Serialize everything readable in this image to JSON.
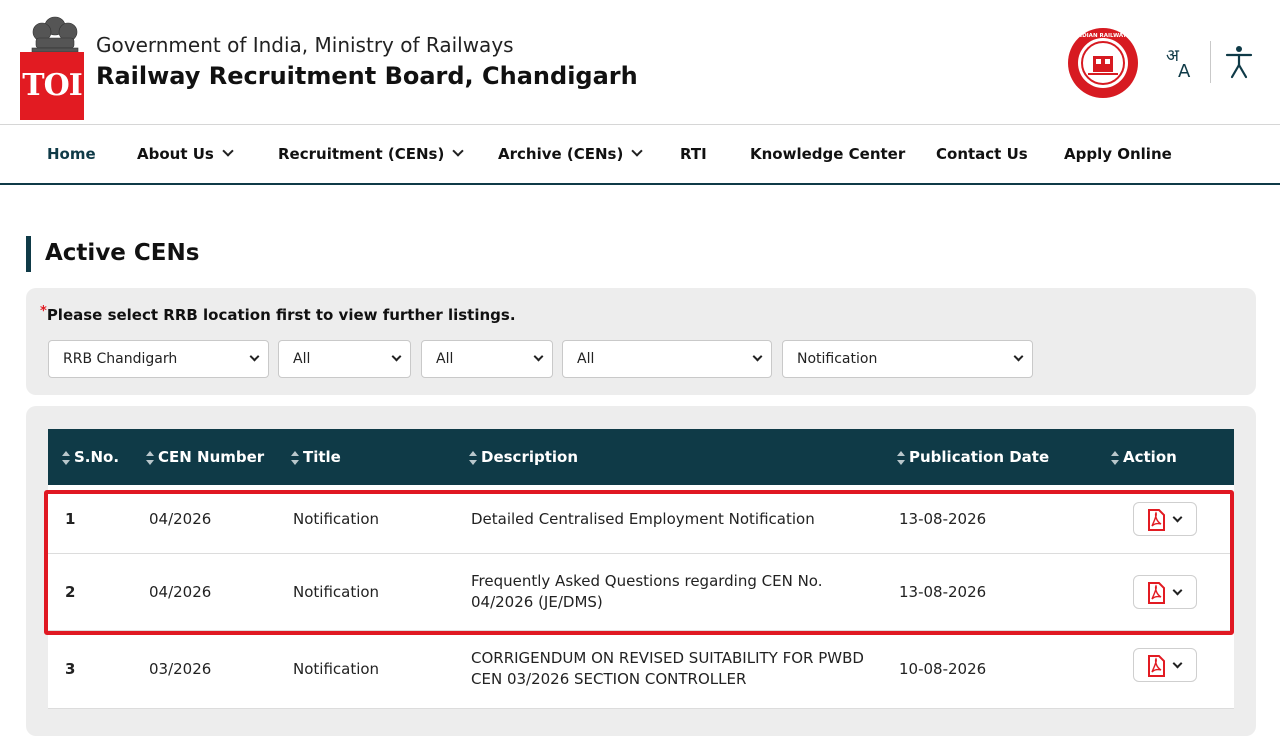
{
  "header": {
    "badge": "TOI",
    "gov_line": "Government of India, Ministry of Railways",
    "board_line": "Railway Recruitment Board, Chandigarh",
    "emblem_icon": "national-emblem-icon",
    "railways_logo": "indian-railways-logo",
    "railways_logo_text": "INDIAN RAILWAYS",
    "language_icon": "language-toggle-icon",
    "language_glyphs": [
      "अ",
      "A"
    ],
    "accessibility_icon": "accessibility-icon"
  },
  "nav": {
    "items": [
      {
        "label": "Home",
        "dropdown": false
      },
      {
        "label": "About Us",
        "dropdown": true
      },
      {
        "label": "Recruitment (CENs)",
        "dropdown": true
      },
      {
        "label": "Archive (CENs)",
        "dropdown": true
      },
      {
        "label": "RTI",
        "dropdown": false
      },
      {
        "label": "Knowledge Center",
        "dropdown": false
      },
      {
        "label": "Contact Us",
        "dropdown": false
      },
      {
        "label": "Apply Online",
        "dropdown": false
      }
    ]
  },
  "page": {
    "title": "Active CENs"
  },
  "filters": {
    "required_mark": "*",
    "note": "Please select RRB location first to view further listings.",
    "selects": [
      {
        "value": "RRB Chandigarh"
      },
      {
        "value": "All"
      },
      {
        "value": "All"
      },
      {
        "value": "All"
      },
      {
        "value": "Notification"
      }
    ]
  },
  "table": {
    "columns": [
      "S.No.",
      "CEN Number",
      "Title",
      "Description",
      "Publication Date",
      "Action"
    ],
    "rows": [
      {
        "sno": "1",
        "cen": "04/2026",
        "title": "Notification",
        "desc": "Detailed Centralised Employment Notification",
        "date": "13-08-2026"
      },
      {
        "sno": "2",
        "cen": "04/2026",
        "title": "Notification",
        "desc": "Frequently Asked Questions regarding CEN No. 04/2026 (JE/DMS)",
        "date": "13-08-2026"
      },
      {
        "sno": "3",
        "cen": "03/2026",
        "title": "Notification",
        "desc": "CORRIGENDUM ON REVISED SUITABILITY FOR PWBD CEN 03/2026 SECTION CONTROLLER",
        "date": "10-08-2026"
      }
    ],
    "action_icon": "pdf-icon"
  },
  "colors": {
    "primary": "#0f3a47",
    "toi_red": "#e21b22",
    "highlight": "#e01822",
    "panel_bg": "#ededed"
  }
}
